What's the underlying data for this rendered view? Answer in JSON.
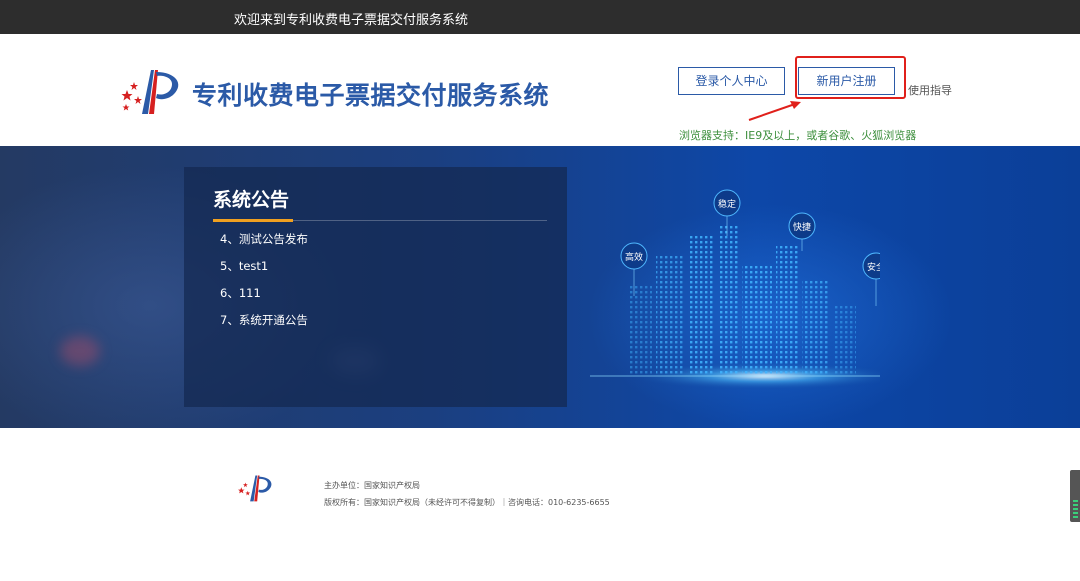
{
  "topbar": {
    "welcome_text": "欢迎来到专利收费电子票据交付服务系统"
  },
  "header": {
    "site_title": "专利收费电子票据交付服务系统",
    "login_button": "登录个人中心",
    "register_button": "新用户注册",
    "guide_link": "使用指导",
    "browser_note": "浏览器支持：IE9及以上，或者谷歌、火狐浏览器"
  },
  "notices": {
    "title": "系统公告",
    "items": [
      "4、测试公告发布",
      "5、test1",
      "6、111",
      "7、系统开通公告"
    ]
  },
  "banner_tags": {
    "stable": "稳定",
    "fast": "快捷",
    "efficient": "高效",
    "safe": "安全"
  },
  "footer": {
    "line1": "主办单位：国家知识产权局",
    "line2": "版权所有：国家知识产权局（未经许可不得复制）｜咨询电话：010-6235-6655"
  },
  "colors": {
    "brand": "#2b5aa7",
    "highlight": "#e0201b",
    "note": "#3d8f3d",
    "accent": "#f0a020"
  }
}
